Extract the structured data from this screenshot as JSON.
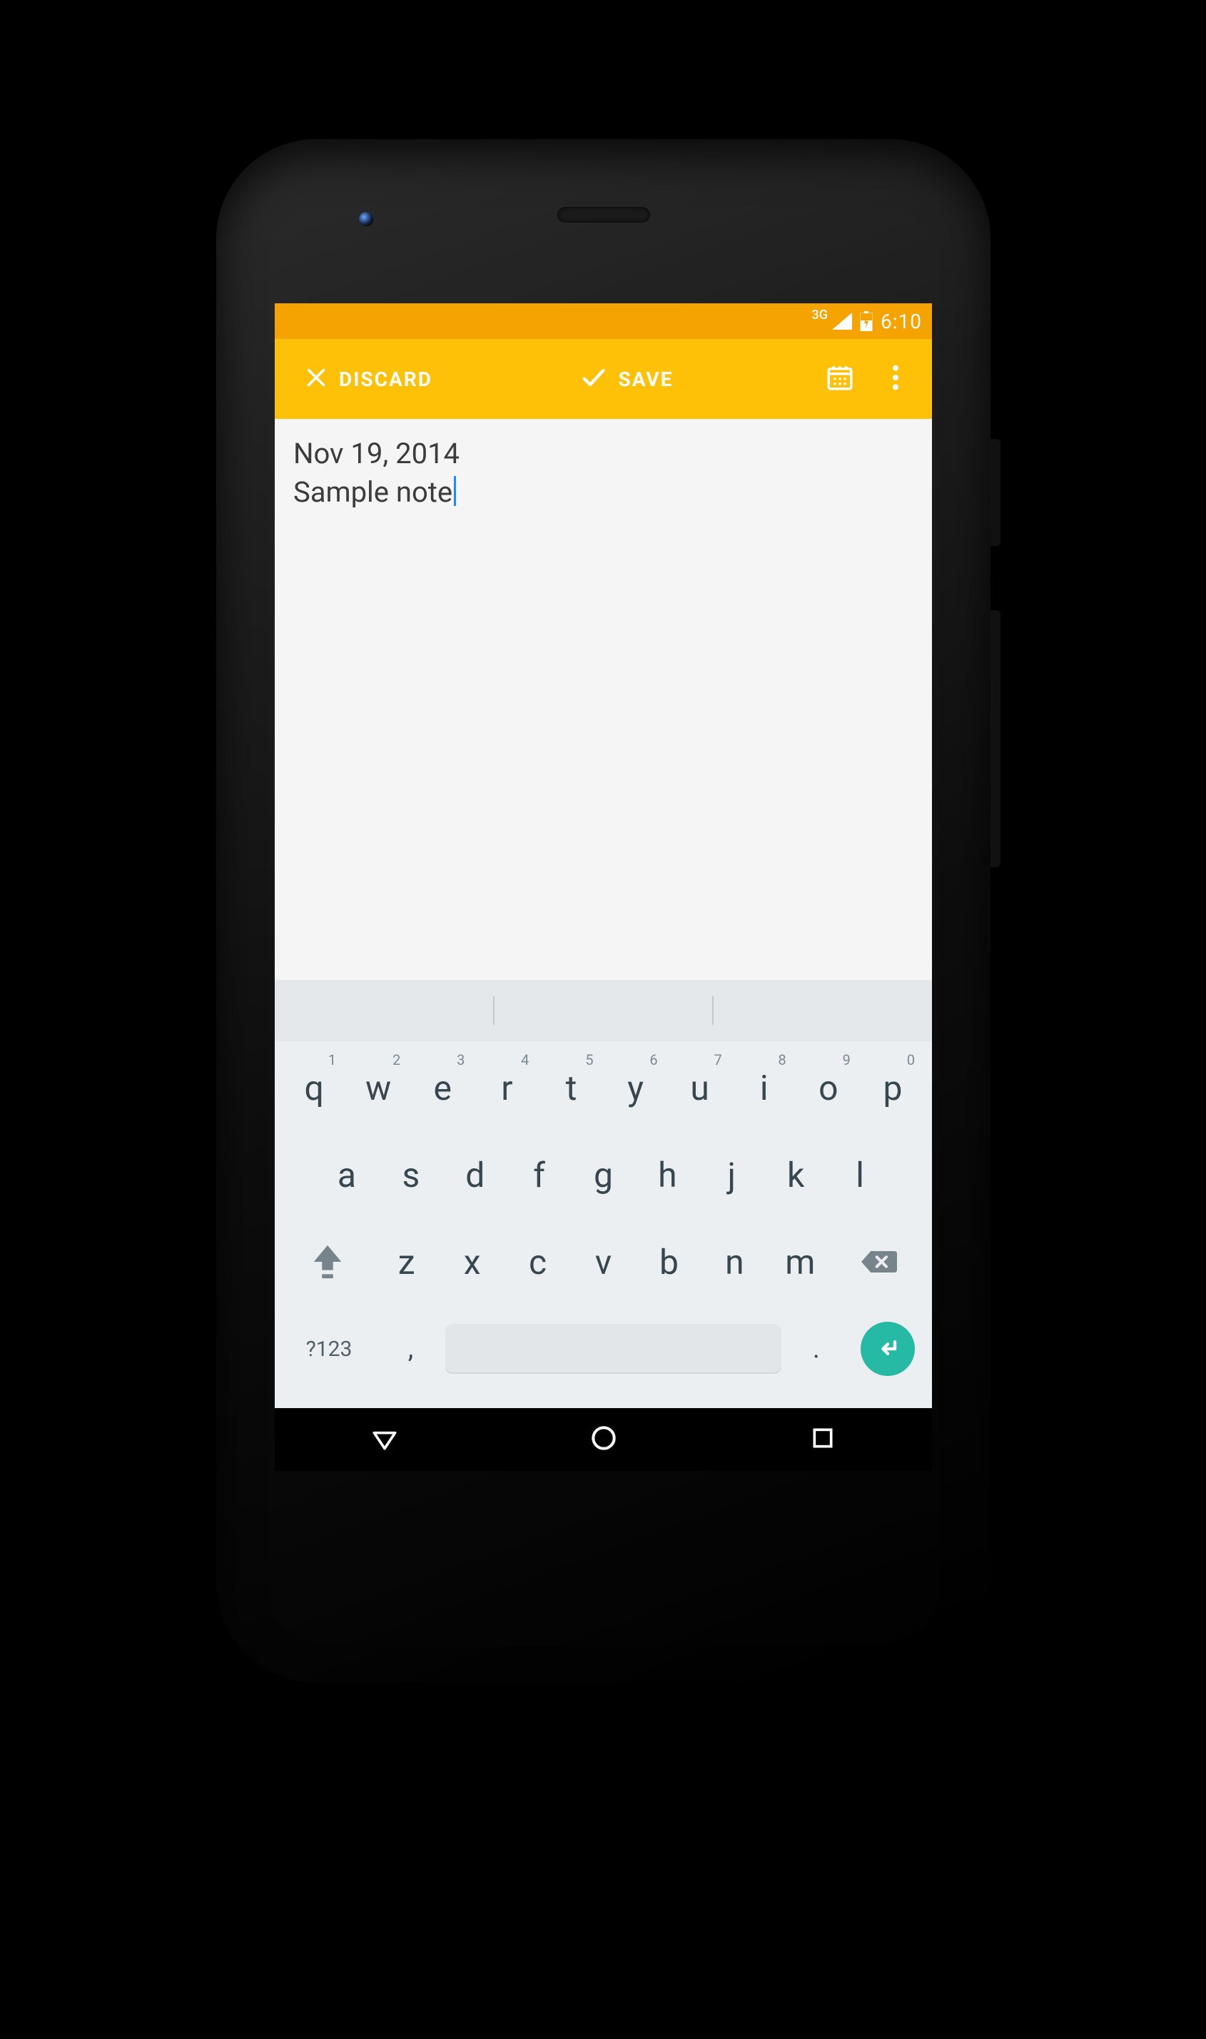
{
  "statusbar": {
    "network_label": "3G",
    "time": "6:10"
  },
  "actionbar": {
    "discard_label": "DISCARD",
    "save_label": "SAVE"
  },
  "note": {
    "date": "Nov 19, 2014",
    "body": "Sample note"
  },
  "keyboard": {
    "row1": [
      {
        "k": "q",
        "s": "1"
      },
      {
        "k": "w",
        "s": "2"
      },
      {
        "k": "e",
        "s": "3"
      },
      {
        "k": "r",
        "s": "4"
      },
      {
        "k": "t",
        "s": "5"
      },
      {
        "k": "y",
        "s": "6"
      },
      {
        "k": "u",
        "s": "7"
      },
      {
        "k": "i",
        "s": "8"
      },
      {
        "k": "o",
        "s": "9"
      },
      {
        "k": "p",
        "s": "0"
      }
    ],
    "row2": [
      "a",
      "s",
      "d",
      "f",
      "g",
      "h",
      "j",
      "k",
      "l"
    ],
    "row3": [
      "z",
      "x",
      "c",
      "v",
      "b",
      "n",
      "m"
    ],
    "symbols_label": "?123",
    "comma": ",",
    "period": "."
  }
}
